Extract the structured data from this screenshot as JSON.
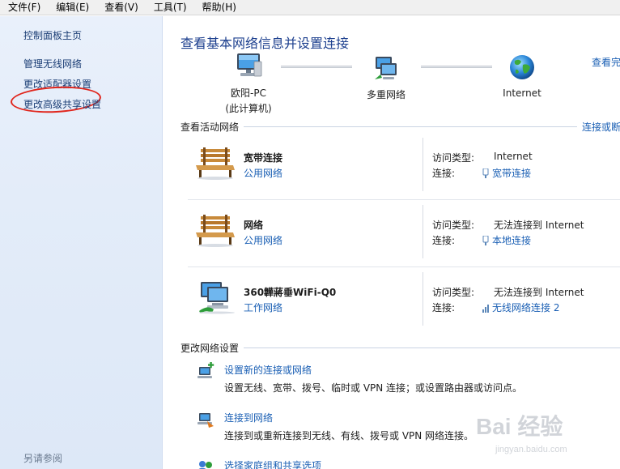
{
  "menu": [
    "文件(F)",
    "编辑(E)",
    "查看(V)",
    "工具(T)",
    "帮助(H)"
  ],
  "sidebar": {
    "items": [
      {
        "label": "控制面板主页"
      },
      {
        "label": "管理无线网络"
      },
      {
        "label": "更改适配器设置"
      },
      {
        "label": "更改高级共享设置"
      }
    ],
    "see_also": "另请参阅"
  },
  "main": {
    "title": "查看基本网络信息并设置连接",
    "view_full_map": "查看完",
    "map": {
      "computer": {
        "name": "欧阳-PC",
        "sub": "(此计算机)"
      },
      "network": {
        "name": "多重网络"
      },
      "internet": {
        "name": "Internet"
      }
    },
    "active_networks": {
      "label": "查看活动网络",
      "link": "连接或断",
      "access_type_label": "访问类型:",
      "connection_label": "连接:",
      "networks": [
        {
          "name": "宽带连接",
          "type": "公用网络",
          "access": "Internet",
          "connection": "宽带连接"
        },
        {
          "name": "网络",
          "type": "公用网络",
          "access": "无法连接到 Internet",
          "connection": "本地连接"
        },
        {
          "name": "360韡蔣垂WiFi-Q0",
          "type": "工作网络",
          "access": "无法连接到 Internet",
          "connection": "无线网络连接 2"
        }
      ]
    },
    "change_settings": {
      "label": "更改网络设置",
      "tasks": [
        {
          "title": "设置新的连接或网络",
          "desc": "设置无线、宽带、拨号、临时或 VPN 连接；或设置路由器或访问点。"
        },
        {
          "title": "连接到网络",
          "desc": "连接到或重新连接到无线、有线、拨号或 VPN 网络连接。"
        },
        {
          "title": "选择家庭组和共享选项",
          "desc": ""
        }
      ]
    }
  },
  "watermark": {
    "text": "Bai 经验",
    "url": "jingyan.baidu.com"
  },
  "colors": {
    "link": "#1a5fb4",
    "title": "#1c3f8e",
    "sidebar_bg": "#e3ecf9",
    "annotation": "#e0261d"
  }
}
